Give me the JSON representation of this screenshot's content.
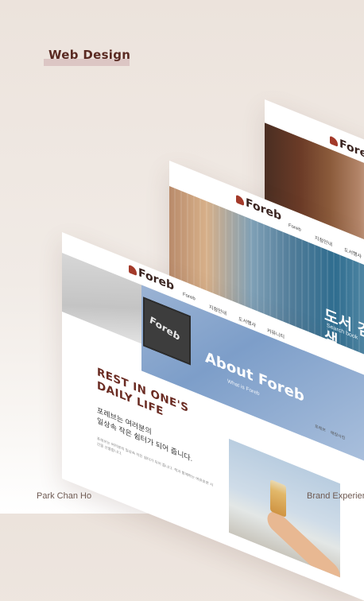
{
  "heading": "Web Design",
  "footer": {
    "author": "Park Chan Ho",
    "category": "Brand Experien"
  },
  "colors": {
    "brand": "#5a2a22",
    "accent": "#a33a2a",
    "highlight_bar": "#dcc6c4"
  },
  "mockup_back": {
    "logo": "Foreb"
  },
  "mockup_middle": {
    "logo": "Foreb",
    "nav": [
      "Foreb",
      "지점안내",
      "도서행사"
    ],
    "hero_title": "도서 검색",
    "hero_subtitle": "Search book"
  },
  "mockup_front": {
    "logo": "Foreb",
    "nav": [
      "Foreb",
      "지점안내",
      "도서행사",
      "커뮤니티"
    ],
    "sign_text": "Foreb",
    "hero_title": "About Foreb",
    "hero_subtitle": "What is Foreb",
    "subnav": [
      "포레브",
      "매장사진"
    ],
    "headline": [
      "REST IN ONE'S",
      "DAILY LIFE"
    ],
    "lead": [
      "포레브는 여러분의",
      "일상속 작은 쉼터가 되어 줍니다."
    ],
    "body": "포레브는 여러분의 일상속 작은 쉼터가 되어 줍니다. 책과 함께하는 여유로운 시간을 선물합니다."
  }
}
